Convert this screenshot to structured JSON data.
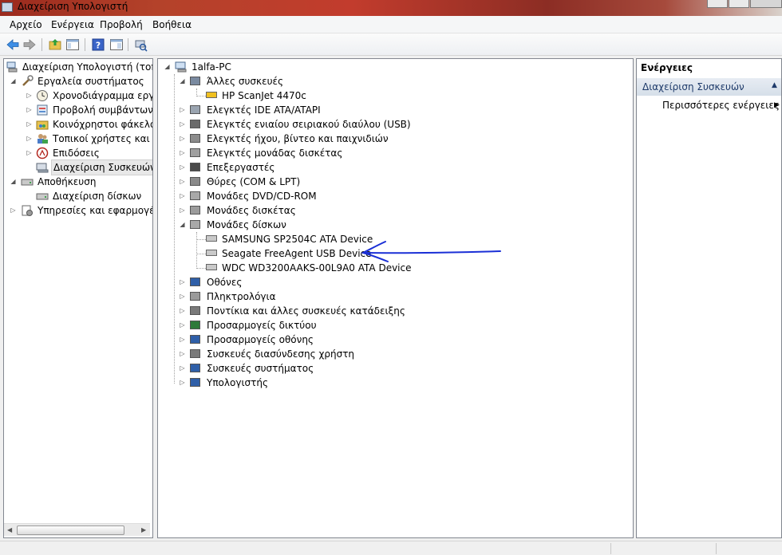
{
  "window": {
    "title": "Διαχείριση Υπολογιστή"
  },
  "menu": [
    "Αρχείο",
    "Ενέργεια",
    "Προβολή",
    "Βοήθεια"
  ],
  "toolbar": {
    "buttons": [
      "back-arrow-icon",
      "forward-arrow-icon",
      "up-folder-icon",
      "show-hide-tree-icon",
      "help-icon",
      "properties-icon",
      "scan-hardware-icon"
    ]
  },
  "left_tree": {
    "root": "Διαχείριση Υπολογιστή (τοπικ",
    "system_tools": "Εργαλεία συστήματος",
    "system_tools_children": [
      "Χρονοδιάγραμμα εργασ",
      "Προβολή συμβάντων",
      "Κοινόχρηστοι φάκελοι",
      "Τοπικοί χρήστες και ομ",
      "Επιδόσεις",
      "Διαχείριση Συσκευών"
    ],
    "storage": "Αποθήκευση",
    "storage_children": [
      "Διαχείριση δίσκων"
    ],
    "services": "Υπηρεσίες και εφαρμογές"
  },
  "device_tree": {
    "computer": "1alfa-PC",
    "categories": [
      {
        "label": "Άλλες συσκευές",
        "expanded": true,
        "children": [
          "HP ScanJet 4470c"
        ]
      },
      {
        "label": "Ελεγκτές IDE ATA/ATAPI"
      },
      {
        "label": "Ελεγκτές ενιαίου σειριακού διαύλου (USB)"
      },
      {
        "label": "Ελεγκτές ήχου, βίντεο και παιχνιδιών"
      },
      {
        "label": "Ελεγκτές μονάδας δισκέτας"
      },
      {
        "label": "Επεξεργαστές"
      },
      {
        "label": "Θύρες (COM & LPT)"
      },
      {
        "label": "Μονάδες DVD/CD-ROM"
      },
      {
        "label": "Μονάδες δισκέτας"
      },
      {
        "label": "Μονάδες δίσκων",
        "expanded": true,
        "children": [
          "SAMSUNG SP2504C ATA Device",
          "Seagate FreeAgent USB Device",
          "WDC WD3200AAKS-00L9A0 ATA Device"
        ]
      },
      {
        "label": "Οθόνες"
      },
      {
        "label": "Πληκτρολόγια"
      },
      {
        "label": "Ποντίκια και άλλες συσκευές κατάδειξης"
      },
      {
        "label": "Προσαρμογείς δικτύου"
      },
      {
        "label": "Προσαρμογείς οθόνης"
      },
      {
        "label": "Συσκευές διασύνδεσης χρήστη"
      },
      {
        "label": "Συσκευές συστήματος"
      },
      {
        "label": "Υπολογιστής"
      }
    ]
  },
  "actions": {
    "header": "Ενέργειες",
    "section": "Διαχείριση Συσκευών",
    "more": "Περισσότερες ενέργειες"
  },
  "colors": {
    "annotation_arrow": "#1a2fd6",
    "selection_bg": "#e8e8e8"
  }
}
